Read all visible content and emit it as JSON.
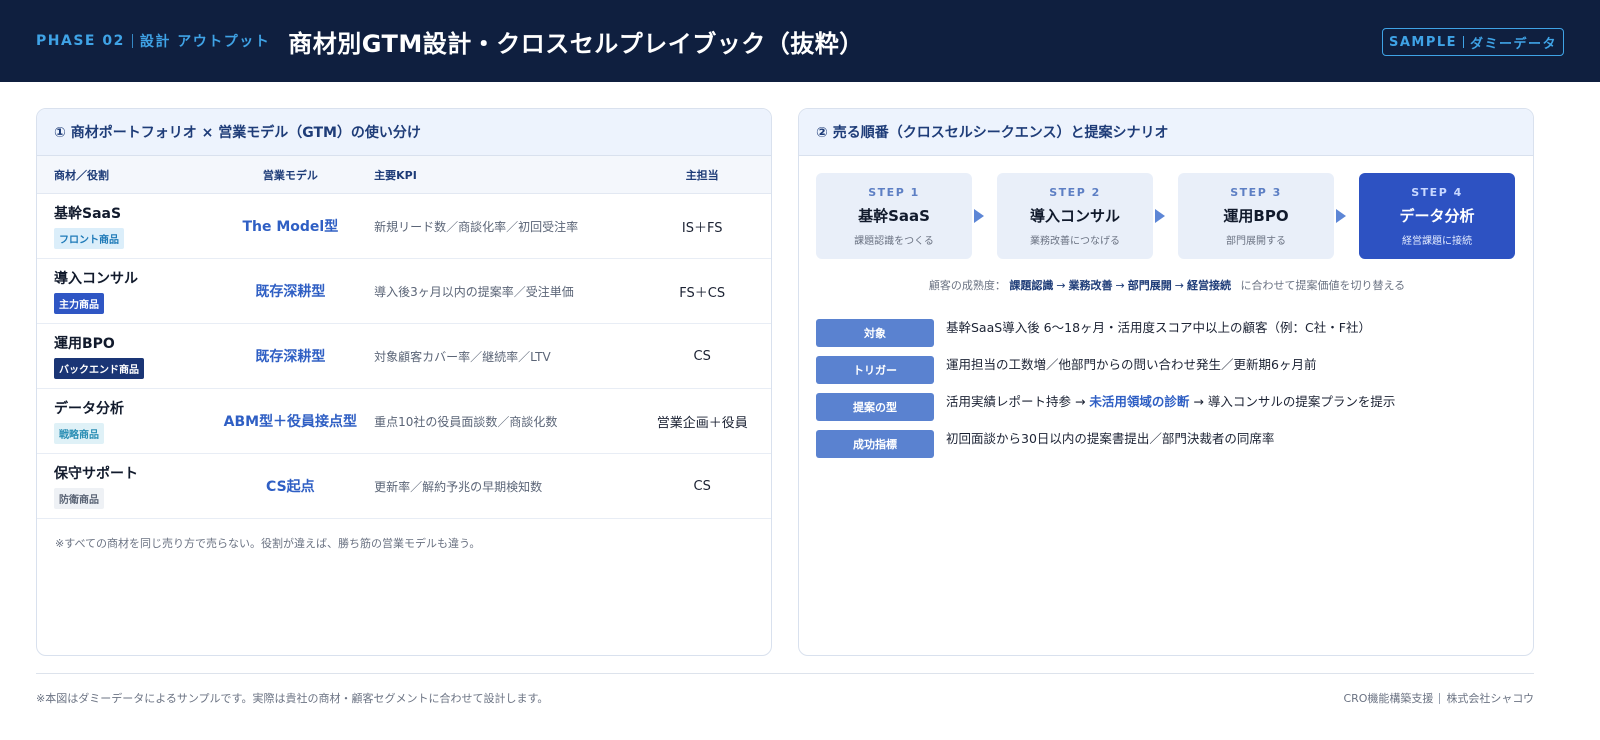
{
  "header": {
    "phase": "PHASE 02",
    "phase_sub": "設計 アウトプット",
    "title": "商材別GTM設計・クロスセルプレイブック（抜粋）",
    "badge_main": "SAMPLE",
    "badge_sub": "ダミーデータ"
  },
  "left_panel": {
    "title": "① 商材ポートフォリオ × 営業モデル（GTM）の使い分け",
    "columns": [
      "商材／役割",
      "営業モデル",
      "主要KPI",
      "主担当"
    ],
    "rows": [
      {
        "name": "基幹SaaS",
        "role": "フロント商品",
        "role_style": "front",
        "model": "The Model型",
        "kpi": "新規リード数／商談化率／初回受注率",
        "owner": "IS＋FS"
      },
      {
        "name": "導入コンサル",
        "role": "主力商品",
        "role_style": "main",
        "model": "既存深耕型",
        "kpi": "導入後3ヶ月以内の提案率／受注単価",
        "owner": "FS＋CS"
      },
      {
        "name": "運用BPO",
        "role": "バックエンド商品",
        "role_style": "back",
        "model": "既存深耕型",
        "kpi": "対象顧客カバー率／継続率／LTV",
        "owner": "CS"
      },
      {
        "name": "データ分析",
        "role": "戦略商品",
        "role_style": "strategy",
        "model": "ABM型＋役員接点型",
        "kpi": "重点10社の役員面談数／商談化数",
        "owner": "営業企画＋役員"
      },
      {
        "name": "保守サポート",
        "role": "防衛商品",
        "role_style": "defense",
        "model": "CS起点",
        "kpi": "更新率／解約予兆の早期検知数",
        "owner": "CS"
      }
    ],
    "note": "※すべての商材を同じ売り方で売らない。役割が違えば、勝ち筋の営業モデルも違う。"
  },
  "right_panel": {
    "title": "② 売る順番（クロスセルシークエンス）と提案シナリオ",
    "steps": [
      {
        "label": "STEP 1",
        "name": "基幹SaaS",
        "desc": "課題認識をつくる"
      },
      {
        "label": "STEP 2",
        "name": "導入コンサル",
        "desc": "業務改善につなげる"
      },
      {
        "label": "STEP 3",
        "name": "運用BPO",
        "desc": "部門展開する"
      },
      {
        "label": "STEP 4",
        "name": "データ分析",
        "desc": "経営課題に接続"
      }
    ],
    "maturity": {
      "prefix": "顧客の成熟度：",
      "stages": [
        "課題認識",
        "業務改善",
        "部門展開",
        "経営接続"
      ],
      "suffix": "に合わせて提案価値を切り替える"
    },
    "scenario": [
      {
        "label": "対象",
        "text": "基幹SaaS導入後 6〜18ヶ月・活用度スコア中以上の顧客（例：C社・F社）"
      },
      {
        "label": "トリガー",
        "text": "運用担当の工数増／他部門からの問い合わせ発生／更新期6ヶ月前"
      },
      {
        "label": "提案の型",
        "text_before": "活用実績レポート持参 → ",
        "text_highlight": "未活用領域の診断",
        "text_after": " → 導入コンサルの提案プランを提示"
      },
      {
        "label": "成功指標",
        "text": "初回面談から30日以内の提案書提出／部門決裁者の同席率"
      }
    ]
  },
  "footer": {
    "left": "※本図はダミーデータによるサンプルです。実際は貴社の商材・顧客セグメントに合わせて設計します。",
    "right_a": "CRO機能構築支援",
    "right_b": "株式会社シャコウ"
  },
  "colors": {
    "header_bg": "#0f1f3f",
    "accent": "#3fa3e6",
    "primary_blue": "#2d52c2",
    "step_bg": "#e9eff9",
    "label_blue": "#5a82d0"
  }
}
